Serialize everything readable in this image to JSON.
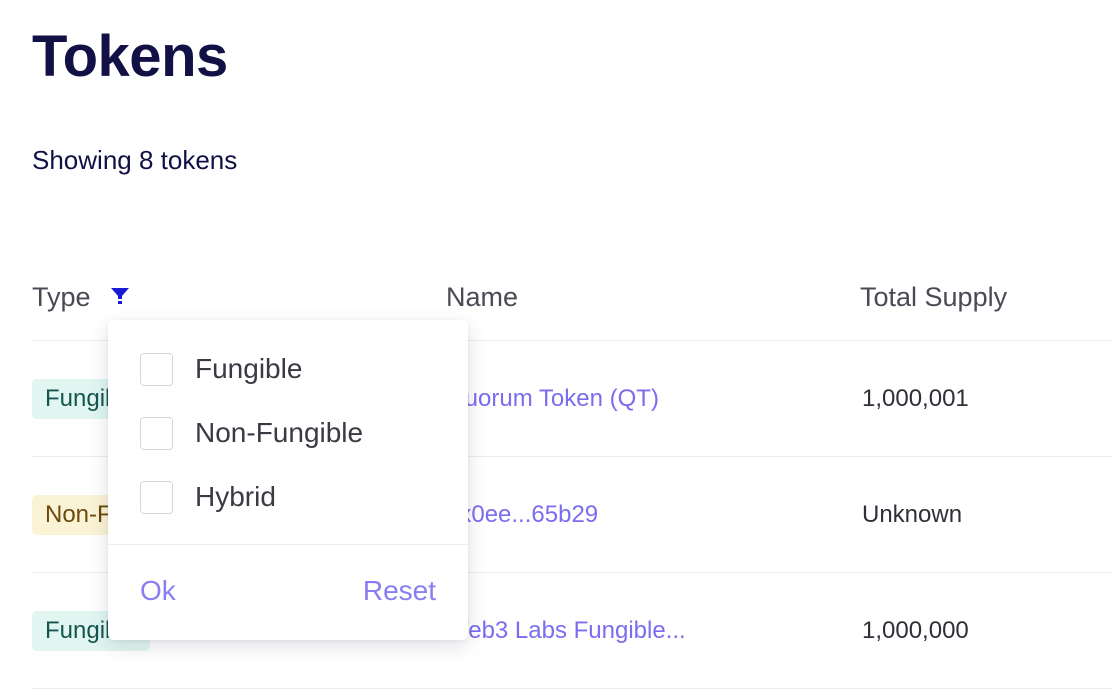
{
  "page": {
    "title": "Tokens",
    "summary": "Showing 8 tokens"
  },
  "table": {
    "columns": {
      "type": "Type",
      "name": "Name",
      "total_supply": "Total Supply"
    },
    "rows": [
      {
        "type": "Fungible",
        "name": "Quorum Token (QT)",
        "total_supply": "1,000,001"
      },
      {
        "type": "Non-Fungible",
        "name": "0x0ee...65b29",
        "total_supply": "Unknown"
      },
      {
        "type": "Fungible",
        "name": "Web3 Labs Fungible...",
        "total_supply": "1,000,000"
      }
    ]
  },
  "filter_dropdown": {
    "options": [
      {
        "label": "Fungible",
        "checked": false
      },
      {
        "label": "Non-Fungible",
        "checked": false
      },
      {
        "label": "Hybrid",
        "checked": false
      }
    ],
    "ok_label": "Ok",
    "reset_label": "Reset"
  },
  "icons": {
    "filter": "filter-icon"
  },
  "colors": {
    "title": "#111146",
    "link": "#7b6cf0",
    "filter_icon": "#1a1ad6",
    "fungible_tag_bg": "#e1f6f1",
    "non_fungible_tag_bg": "#fbf3d6",
    "dropdown_action": "#8a7df2"
  }
}
